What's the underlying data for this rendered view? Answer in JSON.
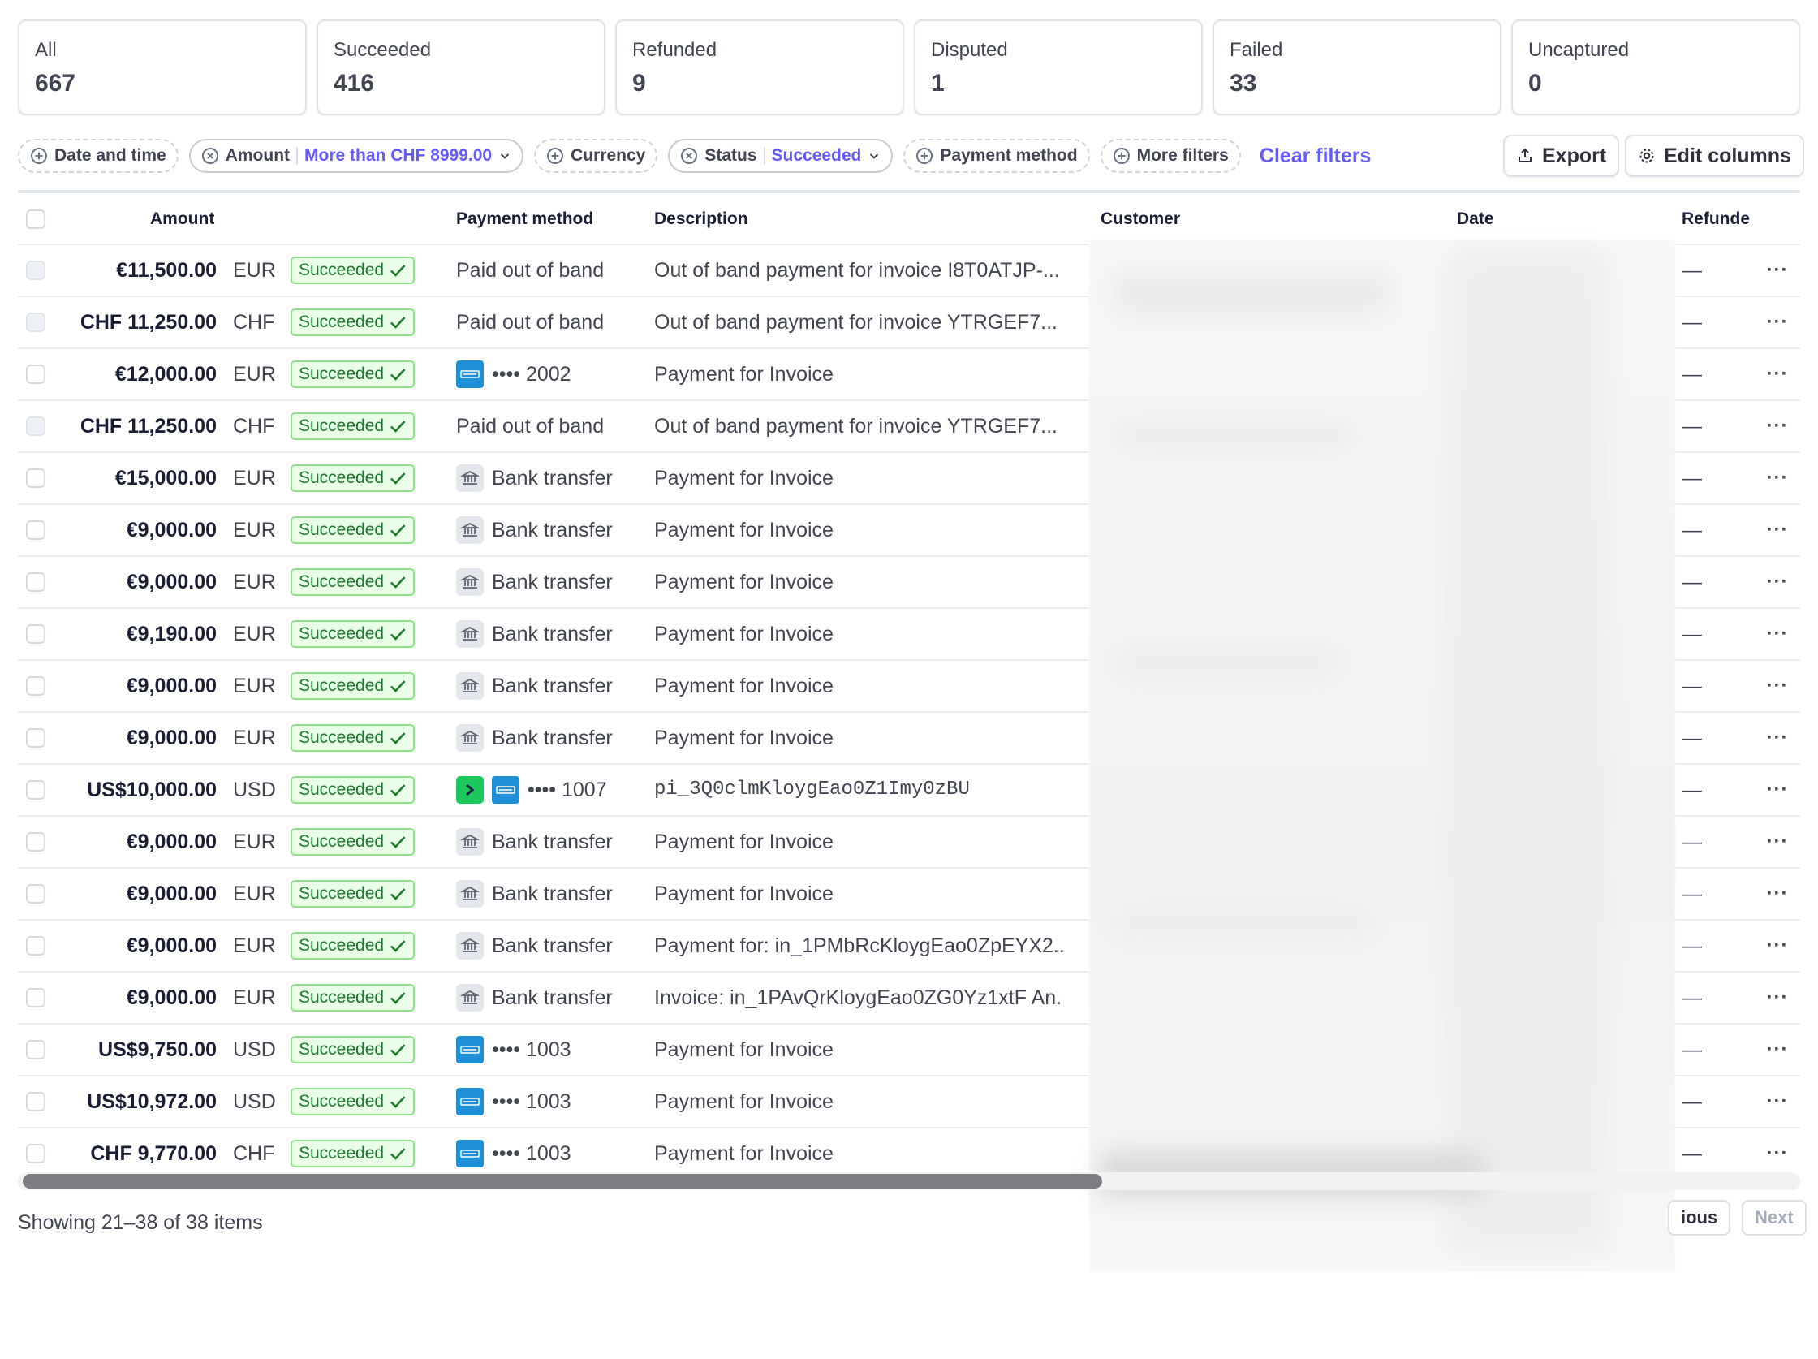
{
  "tabs": [
    {
      "label": "All",
      "count": "667"
    },
    {
      "label": "Succeeded",
      "count": "416"
    },
    {
      "label": "Refunded",
      "count": "9"
    },
    {
      "label": "Disputed",
      "count": "1"
    },
    {
      "label": "Failed",
      "count": "33"
    },
    {
      "label": "Uncaptured",
      "count": "0"
    }
  ],
  "filters": {
    "date": "Date and time",
    "amount_label": "Amount",
    "amount_value": "More than CHF 8999.00",
    "currency": "Currency",
    "status_label": "Status",
    "status_value": "Succeeded",
    "payment_method": "Payment method",
    "more": "More filters",
    "clear": "Clear filters"
  },
  "toolbar": {
    "export": "Export",
    "edit_columns": "Edit columns"
  },
  "columns": {
    "amount": "Amount",
    "payment_method": "Payment method",
    "description": "Description",
    "customer": "Customer",
    "date": "Date",
    "refunded": "Refunde"
  },
  "status_label": "Succeeded",
  "dash": "—",
  "more_dots": "···",
  "rows": [
    {
      "amount": "€11,500.00",
      "currency": "EUR",
      "pm_type": "oob",
      "pm_text": "Paid out of band",
      "desc": "Out of band payment for invoice I8T0ATJP-...",
      "checkbox": "dim"
    },
    {
      "amount": "CHF 11,250.00",
      "currency": "CHF",
      "pm_type": "oob",
      "pm_text": "Paid out of band",
      "desc": "Out of band payment for invoice YTRGEF7...",
      "checkbox": "dim"
    },
    {
      "amount": "€12,000.00",
      "currency": "EUR",
      "pm_type": "card",
      "pm_text": "•••• 2002",
      "desc": "Payment for Invoice",
      "checkbox": "normal"
    },
    {
      "amount": "CHF 11,250.00",
      "currency": "CHF",
      "pm_type": "oob",
      "pm_text": "Paid out of band",
      "desc": "Out of band payment for invoice YTRGEF7...",
      "checkbox": "dim"
    },
    {
      "amount": "€15,000.00",
      "currency": "EUR",
      "pm_type": "bank",
      "pm_text": "Bank transfer",
      "desc": "Payment for Invoice",
      "checkbox": "normal"
    },
    {
      "amount": "€9,000.00",
      "currency": "EUR",
      "pm_type": "bank",
      "pm_text": "Bank transfer",
      "desc": "Payment for Invoice",
      "checkbox": "normal"
    },
    {
      "amount": "€9,000.00",
      "currency": "EUR",
      "pm_type": "bank",
      "pm_text": "Bank transfer",
      "desc": "Payment for Invoice",
      "checkbox": "normal"
    },
    {
      "amount": "€9,190.00",
      "currency": "EUR",
      "pm_type": "bank",
      "pm_text": "Bank transfer",
      "desc": "Payment for Invoice",
      "checkbox": "normal"
    },
    {
      "amount": "€9,000.00",
      "currency": "EUR",
      "pm_type": "bank",
      "pm_text": "Bank transfer",
      "desc": "Payment for Invoice",
      "checkbox": "normal"
    },
    {
      "amount": "€9,000.00",
      "currency": "EUR",
      "pm_type": "bank",
      "pm_text": "Bank transfer",
      "desc": "Payment for Invoice",
      "checkbox": "normal"
    },
    {
      "amount": "US$10,000.00",
      "currency": "USD",
      "pm_type": "link-card",
      "pm_text": "•••• 1007",
      "desc": "pi_3Q0clmKloygEao0Z1Imy0zBU",
      "mono": true,
      "checkbox": "normal"
    },
    {
      "amount": "€9,000.00",
      "currency": "EUR",
      "pm_type": "bank",
      "pm_text": "Bank transfer",
      "desc": "Payment for Invoice",
      "checkbox": "normal"
    },
    {
      "amount": "€9,000.00",
      "currency": "EUR",
      "pm_type": "bank",
      "pm_text": "Bank transfer",
      "desc": "Payment for Invoice",
      "checkbox": "normal"
    },
    {
      "amount": "€9,000.00",
      "currency": "EUR",
      "pm_type": "bank",
      "pm_text": "Bank transfer",
      "desc": "Payment for: in_1PMbRcKloygEao0ZpEYX2..",
      "checkbox": "normal"
    },
    {
      "amount": "€9,000.00",
      "currency": "EUR",
      "pm_type": "bank",
      "pm_text": "Bank transfer",
      "desc": "Invoice: in_1PAvQrKloygEao0ZG0Yz1xtF An.",
      "checkbox": "normal"
    },
    {
      "amount": "US$9,750.00",
      "currency": "USD",
      "pm_type": "card",
      "pm_text": "•••• 1003",
      "desc": "Payment for Invoice",
      "checkbox": "normal"
    },
    {
      "amount": "US$10,972.00",
      "currency": "USD",
      "pm_type": "card",
      "pm_text": "•••• 1003",
      "desc": "Payment for Invoice",
      "checkbox": "normal"
    },
    {
      "amount": "CHF 9,770.00",
      "currency": "CHF",
      "pm_type": "card",
      "pm_text": "•••• 1003",
      "desc": "Payment for Invoice",
      "checkbox": "normal"
    }
  ],
  "footer": {
    "showing": "Showing 21–38 of 38 items",
    "previous": "ious",
    "next": "Next"
  },
  "colors": {
    "accent": "#635bff",
    "success_bg": "#eaffe8",
    "success_border": "#8ee28a",
    "success_text": "#1b7a2c",
    "card_brand": "#1f8fd6",
    "link_brand": "#1cc85b"
  }
}
